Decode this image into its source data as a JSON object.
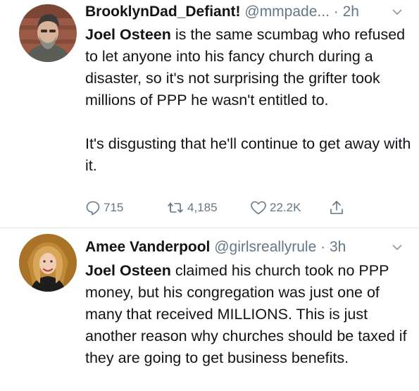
{
  "tweets": [
    {
      "display_name": "BrooklynDad_Defiant!",
      "handle": "@mmpade...",
      "separator": " · ",
      "time": "2h",
      "body_mention": "Joel Osteen",
      "body_p1": " is the same scumbag who refused to let anyone into his fancy church during a disaster, so it's not surprising the grifter took millions of PPP he wasn't entitled to.",
      "body_p2": "It's disgusting that he'll continue to get away with it.",
      "replies": "715",
      "retweets": "4,185",
      "likes": "22.2K"
    },
    {
      "display_name": "Amee Vanderpool",
      "handle": "@girlsreallyrule",
      "separator": " · ",
      "time": "3h",
      "body_mention": "Joel Osteen",
      "body_p1": " claimed his church took no PPP money, but his congregation was just one of many that received MILLIONS. This is just another reason why churches should be taxed if they are going to get business benefits."
    }
  ],
  "icons": {
    "reply": "reply-icon",
    "retweet": "retweet-icon",
    "like": "heart-icon",
    "share": "share-icon",
    "more": "chevron-down-icon"
  },
  "colors": {
    "text": "#0f1419",
    "secondary": "#657786",
    "divider": "#e6e6e6"
  }
}
